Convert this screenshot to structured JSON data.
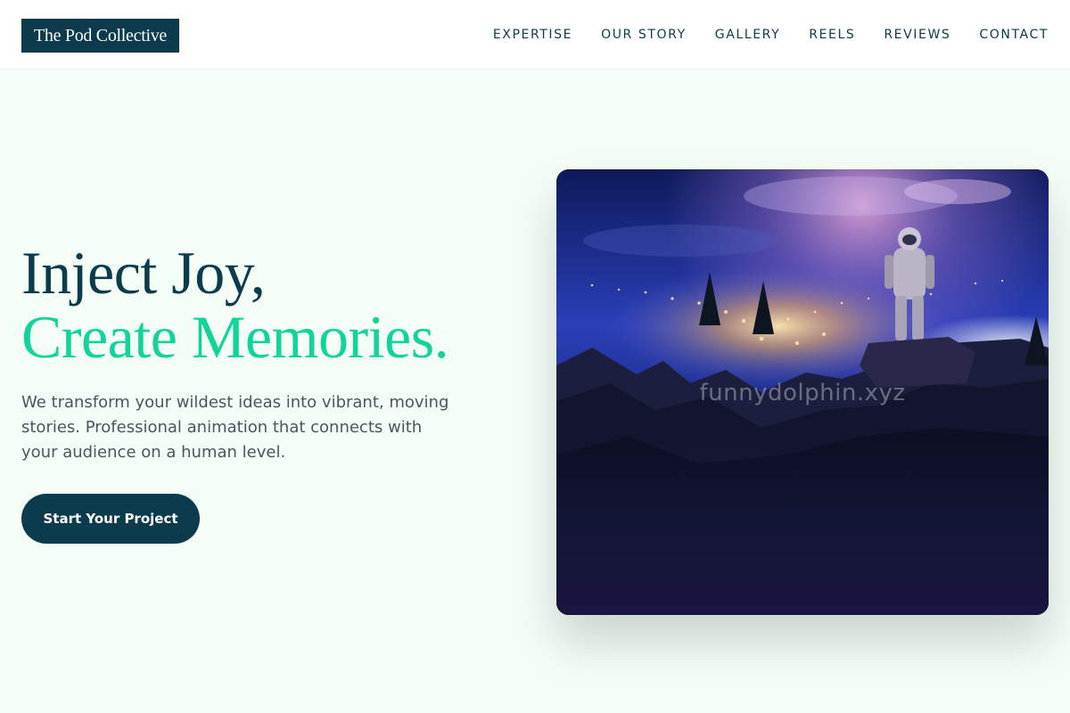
{
  "brand": {
    "name": "The Pod Collective"
  },
  "nav": {
    "items": [
      {
        "label": "EXPERTISE"
      },
      {
        "label": "OUR STORY"
      },
      {
        "label": "GALLERY"
      },
      {
        "label": "REELS"
      },
      {
        "label": "REVIEWS"
      },
      {
        "label": "CONTACT"
      }
    ]
  },
  "hero": {
    "headline_line1": "Inject Joy,",
    "headline_line2": "Create Memories.",
    "description": "We transform your wildest ideas into vibrant, moving stories. Professional animation that connects with your audience on a human level.",
    "cta_label": "Start Your Project",
    "image": {
      "subject": "astronaut on cliff overlooking city lights at night",
      "watermark": "funnydolphin.xyz"
    }
  },
  "colors": {
    "primary": "#0b3b4c",
    "accent": "#12d49b",
    "page_background": "#f4fdf6",
    "body_text": "#4a5660"
  }
}
